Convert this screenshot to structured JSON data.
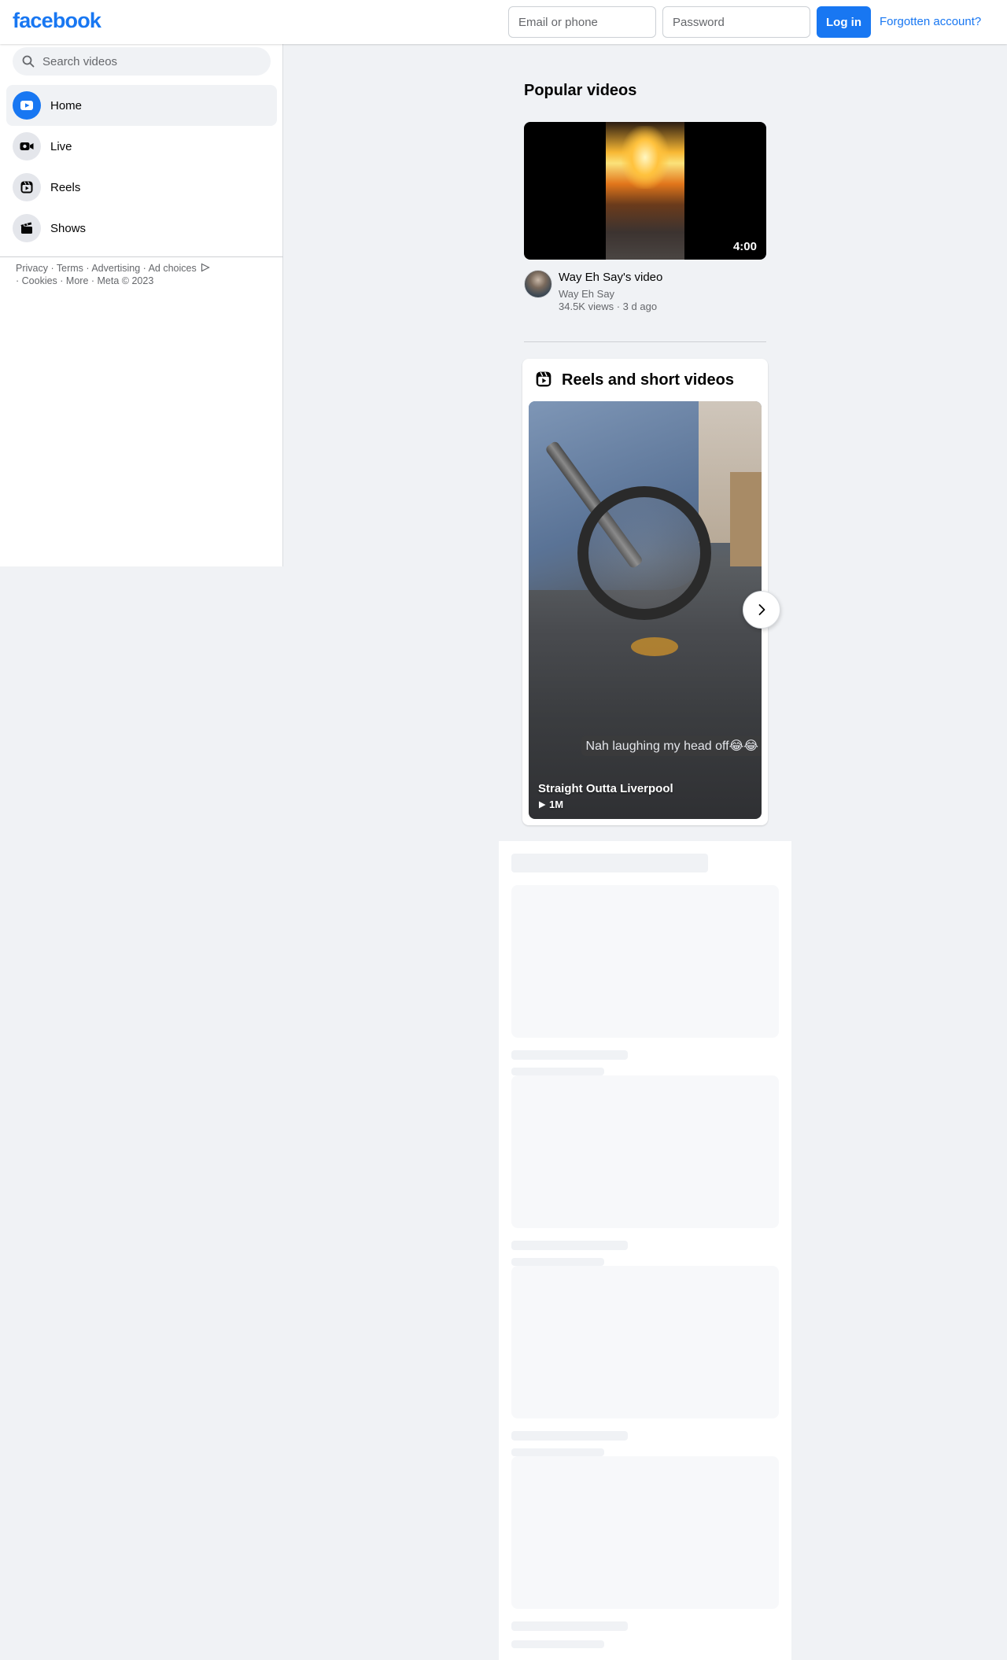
{
  "header": {
    "logo_text": "facebook",
    "email_placeholder": "Email or phone",
    "password_placeholder": "Password",
    "login_label": "Log in",
    "forgot_label": "Forgotten account?"
  },
  "sidebar": {
    "search_placeholder": "Search videos",
    "items": [
      {
        "label": "Home",
        "icon": "video-play-icon",
        "active": true
      },
      {
        "label": "Live",
        "icon": "live-camera-icon",
        "active": false
      },
      {
        "label": "Reels",
        "icon": "reels-icon",
        "active": false
      },
      {
        "label": "Shows",
        "icon": "clapperboard-icon",
        "active": false
      }
    ],
    "footer": {
      "privacy": "Privacy",
      "terms": "Terms",
      "advertising": "Advertising",
      "ad_choices": "Ad choices",
      "cookies": "Cookies",
      "more": "More",
      "copyright": "Meta © 2023"
    }
  },
  "main": {
    "popular_title": "Popular videos",
    "popular_video": {
      "duration": "4:00",
      "title": "Way Eh Say's video",
      "channel": "Way Eh Say",
      "views": "34.5K views",
      "age": "3 d ago"
    },
    "reels": {
      "title": "Reels and short videos",
      "items": [
        {
          "overlay_text": "Nah laughing my head off😂😂",
          "caption": "Straight Outta Liverpool",
          "views": "1M"
        }
      ]
    }
  },
  "colors": {
    "brand": "#1877f2",
    "page_bg": "#f0f2f5",
    "secondary_text": "#65676b"
  }
}
